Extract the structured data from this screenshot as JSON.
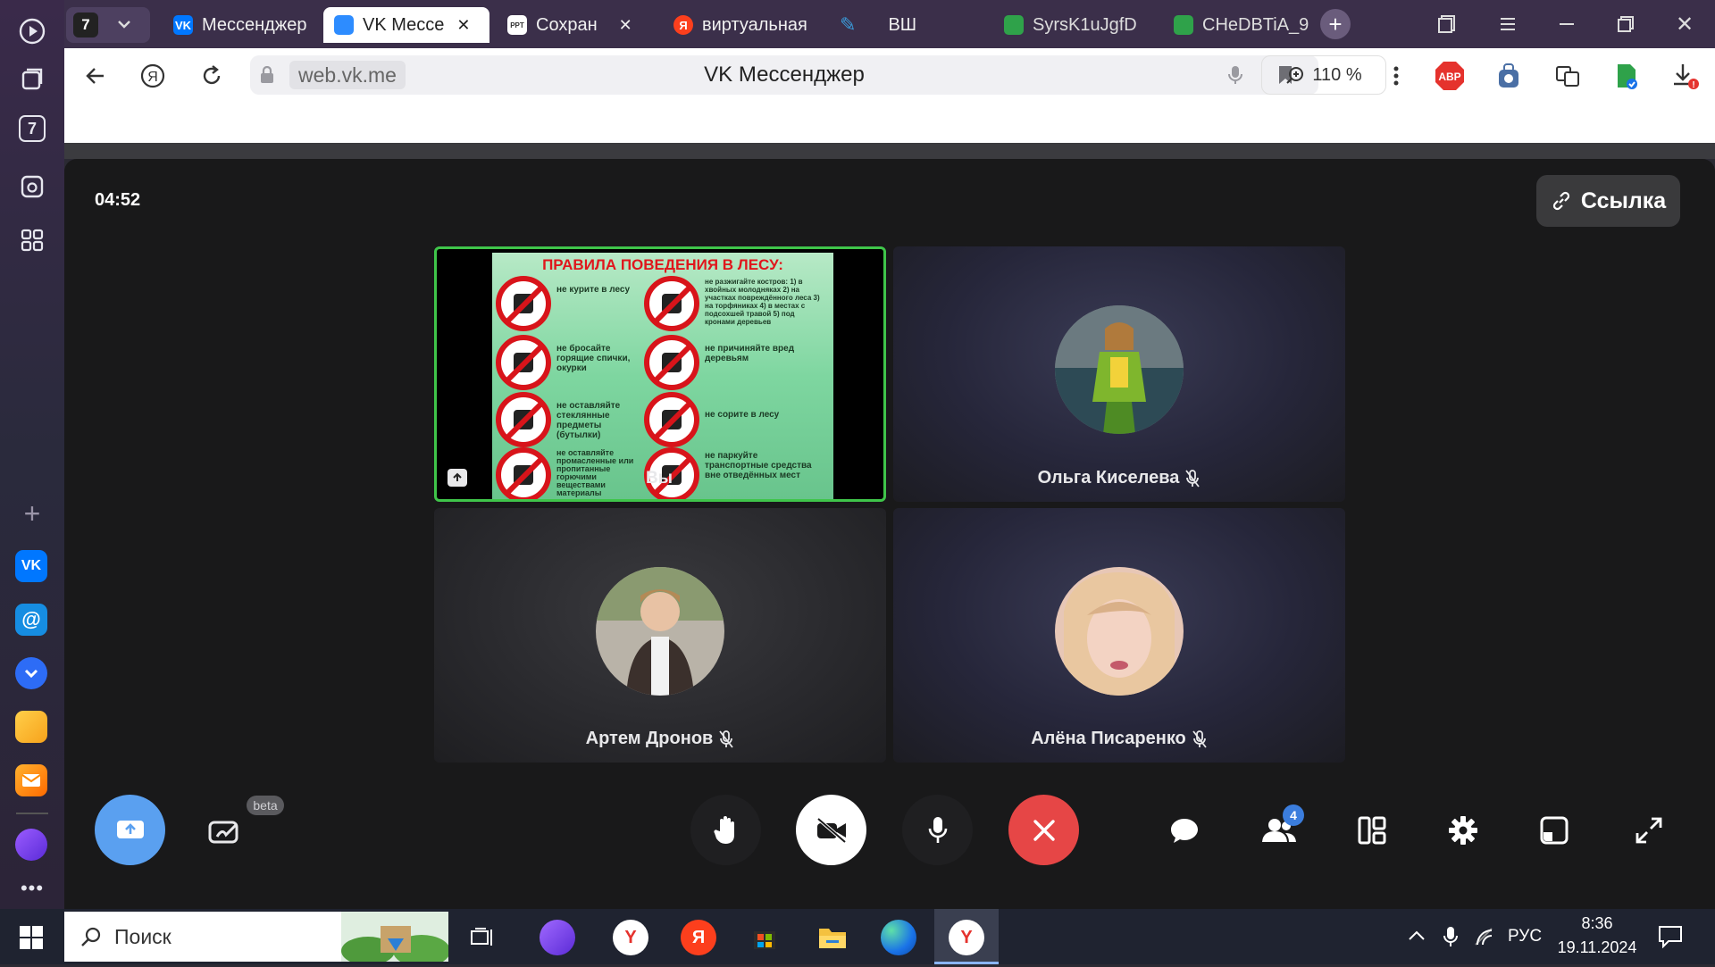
{
  "sidebar": {
    "badge": "7"
  },
  "tabs": {
    "group_label": "7",
    "items": [
      {
        "label": "Мессенджер",
        "favicon": "VK",
        "color": "#0077ff"
      },
      {
        "label": "VK Мессе",
        "favicon": "",
        "color": "#2d8cff",
        "close": "✕"
      },
      {
        "label": "Сохран",
        "favicon": "PPT",
        "color": "#555"
      },
      {
        "label": "виртуальная",
        "favicon": "Я",
        "color": "#fc3f1d"
      },
      {
        "label": "ВШ",
        "favicon": "",
        "color": "#2a8ad4"
      },
      {
        "label": "SyrsK1uJgfD",
        "favicon": "",
        "color": "#2fa24a"
      },
      {
        "label": "CHeDBTiA_9",
        "favicon": "",
        "color": "#2fa24a"
      }
    ]
  },
  "toolbar": {
    "url": "web.vk.me",
    "title": "VK Мессенджер",
    "zoom": "110 %",
    "abp": "ABP"
  },
  "call": {
    "timer": "04:52",
    "link_label": "Ссылка",
    "slide": {
      "title": "ПРАВИЛА ПОВЕДЕНИЯ В ЛЕСУ:",
      "rules_left": [
        "не курите в лесу",
        "не бросайте горящие спички, окурки",
        "не оставляйте стеклянные предметы (бутылки)",
        "не оставляйте промасленные или пропитанные горючими веществами материалы"
      ],
      "rules_right": [
        "не разжигайте костров: 1) в хвойных молодняках 2) на участках повреждённого леса 3) на торфяниках 4) в местах с подсохшей травой 5) под кронами деревьев",
        "не причиняйте вред деревьям",
        "не сорите в лесу",
        "не паркуйте транспортные средства вне отведённых мест"
      ]
    },
    "participants": [
      {
        "name": "Вы"
      },
      {
        "name": "Ольга Киселева"
      },
      {
        "name": "Артем Дронов"
      },
      {
        "name": "Алёна Писаренко"
      }
    ],
    "beta_label": "beta",
    "participants_count": "4"
  },
  "taskbar": {
    "search_placeholder": "Поиск",
    "lang": "РУС",
    "time": "8:36",
    "date": "19.11.2024"
  }
}
